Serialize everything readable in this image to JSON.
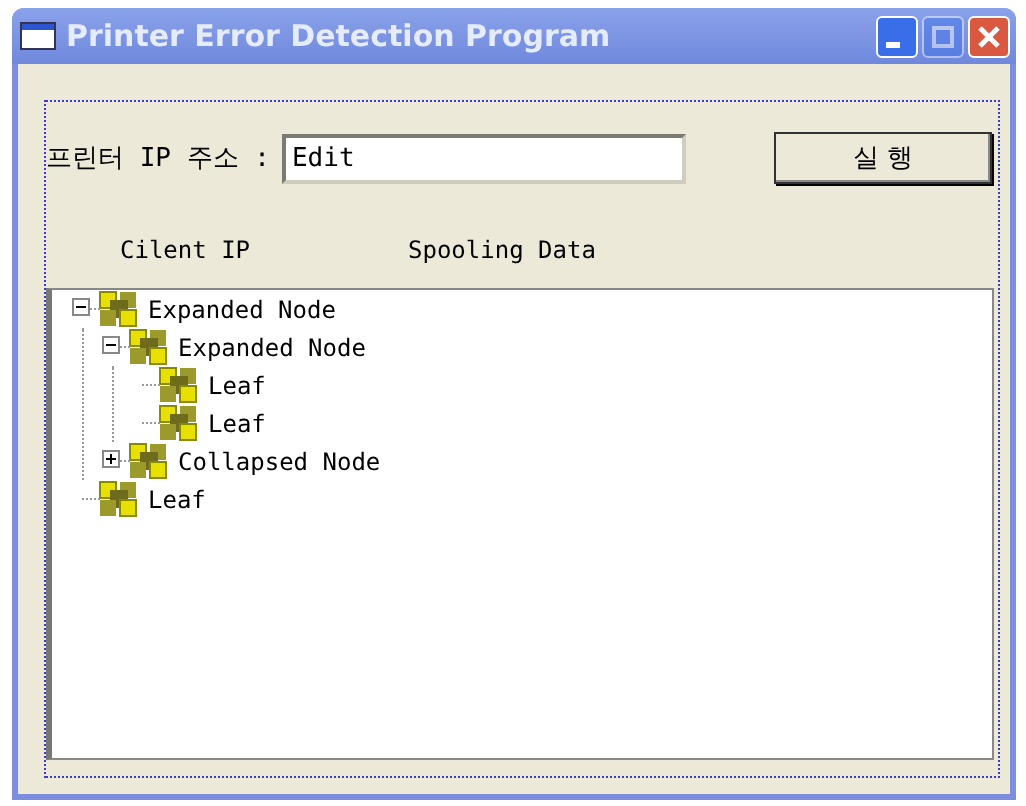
{
  "window": {
    "title": "Printer Error Detection Program",
    "buttons": [
      {
        "kind": "minimize",
        "disabled": false
      },
      {
        "kind": "maximize",
        "disabled": true
      },
      {
        "kind": "close",
        "disabled": false
      }
    ]
  },
  "ip_field": {
    "label": "프린터 IP 주소 :",
    "value": "Edit"
  },
  "run_button": {
    "label": "실 행"
  },
  "columns": [
    "Cilent IP",
    "Spooling Data"
  ],
  "tree": [
    {
      "label": "Expanded Node",
      "kind": "node",
      "expanded": true,
      "children": [
        {
          "label": "Expanded Node",
          "kind": "node",
          "expanded": true,
          "children": [
            {
              "label": "Leaf",
              "kind": "leaf"
            },
            {
              "label": "Leaf",
              "kind": "leaf"
            }
          ]
        },
        {
          "label": "Collapsed Node",
          "kind": "node",
          "expanded": false
        }
      ]
    },
    {
      "label": "Leaf",
      "kind": "leaf"
    }
  ]
}
